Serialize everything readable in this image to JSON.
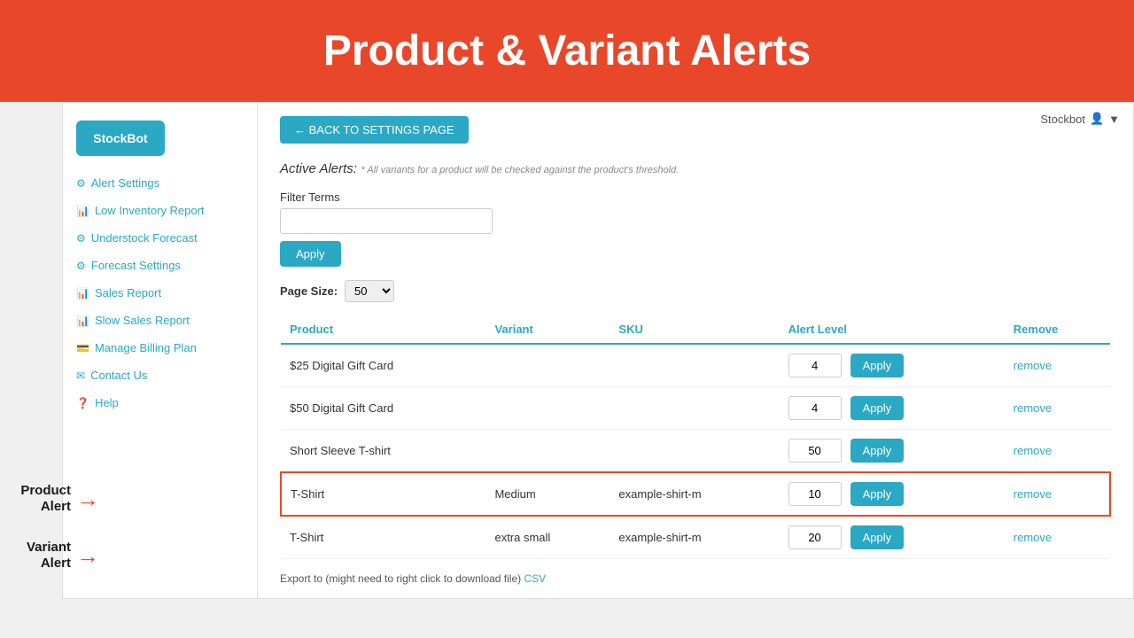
{
  "page": {
    "banner_title": "Product & Variant Alerts"
  },
  "header": {
    "user": "Stockbot",
    "user_icon": "👤",
    "dropdown_arrow": "▼"
  },
  "sidebar": {
    "logo_text": "StockBot",
    "nav_items": [
      {
        "icon": "⚙",
        "label": "Alert Settings"
      },
      {
        "icon": "📊",
        "label": "Low Inventory Report"
      },
      {
        "icon": "⚙",
        "label": "Understock Forecast"
      },
      {
        "icon": "⚙",
        "label": "Forecast Settings"
      },
      {
        "icon": "📊",
        "label": "Sales Report"
      },
      {
        "icon": "📊",
        "label": "Slow Sales Report"
      },
      {
        "icon": "💳",
        "label": "Manage Billing Plan"
      },
      {
        "icon": "✉",
        "label": "Contact Us"
      },
      {
        "icon": "❓",
        "label": "Help"
      }
    ]
  },
  "main": {
    "back_button": "← BACK TO SETTINGS PAGE",
    "active_alerts_title": "Active Alerts:",
    "active_alerts_note": "* All variants for a product will be checked against the product's threshold.",
    "filter_label": "Filter Terms",
    "filter_placeholder": "",
    "filter_apply": "Apply",
    "page_size_label": "Page Size:",
    "page_size_value": "50",
    "table": {
      "headers": [
        "Product",
        "Variant",
        "SKU",
        "Alert Level",
        "Remove"
      ],
      "rows": [
        {
          "product": "$25 Digital Gift Card",
          "variant": "",
          "sku": "",
          "alert_level": "4",
          "is_variant_highlight": false
        },
        {
          "product": "$50 Digital Gift Card",
          "variant": "",
          "sku": "",
          "alert_level": "4",
          "is_variant_highlight": false
        },
        {
          "product": "Short Sleeve T-shirt",
          "variant": "",
          "sku": "",
          "alert_level": "50",
          "is_variant_highlight": false
        },
        {
          "product": "T-Shirt",
          "variant": "Medium",
          "sku": "example-shirt-m",
          "alert_level": "10",
          "is_variant_highlight": true
        },
        {
          "product": "T-Shirt",
          "variant": "extra small",
          "sku": "example-shirt-m",
          "alert_level": "20",
          "is_variant_highlight": false
        }
      ],
      "apply_btn": "Apply",
      "remove_link": "remove"
    },
    "export_text": "Export to (might need to right click to download file)",
    "csv_link": "CSV"
  },
  "annotations": [
    {
      "label": "Product\nAlert",
      "arrow": "→"
    },
    {
      "label": "Variant\nAlert",
      "arrow": "→"
    }
  ]
}
